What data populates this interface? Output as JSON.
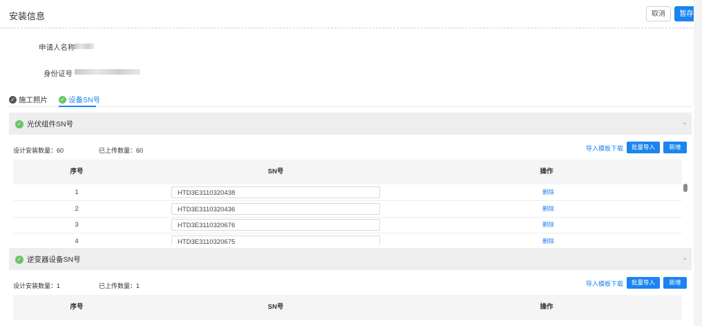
{
  "header": {
    "title": "安装信息",
    "cancel_label": "取消",
    "save_label": "暂存"
  },
  "form": {
    "applicant_label": "申请人名称",
    "id_label": "身份证号"
  },
  "tabs": [
    {
      "label": "施工照片",
      "status_color": "#555555"
    },
    {
      "label": "设备SN号",
      "status_color": "#6bc365"
    }
  ],
  "sections": [
    {
      "title": "光伏组件SN号",
      "design_label": "设计安装数量：60",
      "uploaded_label": "已上传数量：60",
      "template_link": "导入模板下载",
      "batch_import_label": "批量导入",
      "add_label": "新增",
      "columns": [
        "序号",
        "SN号",
        "操作"
      ],
      "rows": [
        {
          "no": "1",
          "sn": "HTD3E3110320438",
          "action": "删除"
        },
        {
          "no": "2",
          "sn": "HTD3E3110320436",
          "action": "删除"
        },
        {
          "no": "3",
          "sn": "HTD3E3110320676",
          "action": "删除"
        },
        {
          "no": "4",
          "sn": "HTD3E3110320675",
          "action": "删除"
        }
      ]
    },
    {
      "title": "逆变器设备SN号",
      "design_label": "设计安装数量：1",
      "uploaded_label": "已上传数量：1",
      "template_link": "导入模板下载",
      "batch_import_label": "批量导入",
      "add_label": "新增",
      "columns": [
        "序号",
        "SN号",
        "操作"
      ]
    }
  ],
  "colors": {
    "accent": "#1a84f0",
    "success": "#6bc365"
  }
}
